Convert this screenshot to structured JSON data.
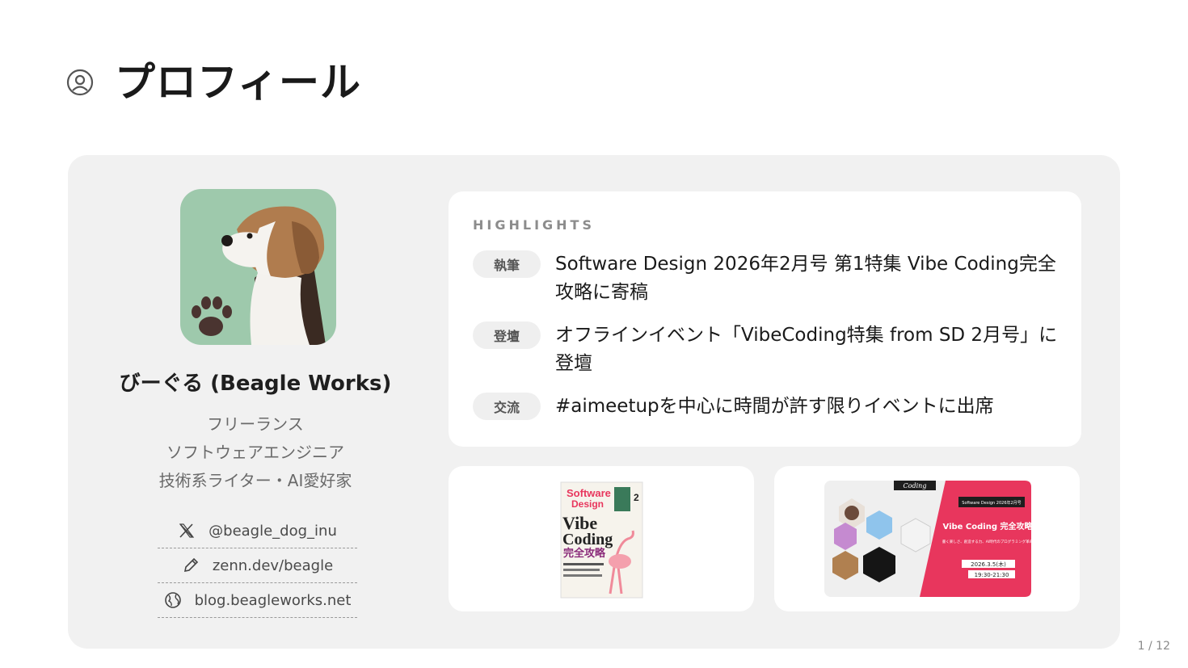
{
  "slide": {
    "title": "プロフィール",
    "page": "1 / 12"
  },
  "profile": {
    "name": "びーぐる (Beagle Works)",
    "roles": [
      "フリーランス",
      "ソフトウェアエンジニア",
      "技術系ライター・AI愛好家"
    ],
    "links": [
      {
        "icon": "x-logo-icon",
        "text": "@beagle_dog_inu"
      },
      {
        "icon": "pen-icon",
        "text": "zenn.dev/beagle"
      },
      {
        "icon": "globe-icon",
        "text": "blog.beagleworks.net"
      }
    ]
  },
  "highlights": {
    "heading": "HIGHLIGHTS",
    "items": [
      {
        "badge": "執筆",
        "text": "Software Design 2026年2月号 第1特集 Vibe Coding完全攻略に寄稿"
      },
      {
        "badge": "登壇",
        "text": "オフラインイベント「VibeCoding特集 from SD 2月号」に登壇"
      },
      {
        "badge": "交流",
        "text": "#aimeetupを中心に時間が許す限りイベントに出席"
      }
    ]
  },
  "magazine": {
    "brand_top": "Software",
    "brand_bottom": "Design",
    "issue": "2",
    "headline_1": "Vibe",
    "headline_2": "Coding",
    "headline_3": "完全攻略"
  },
  "event": {
    "brand": "Coding",
    "tag": "Software Design 2026年2月号",
    "title": "Vibe Coding 完全攻略",
    "subtitle": "書く楽しさ、創造する力、AI時代のプログラミング革命",
    "date": "2026.3.5(木)",
    "time": "19:30-21:30"
  },
  "colors": {
    "accent_pink": "#e8365d",
    "avatar_bg": "#9ec9ac",
    "card_bg": "#f1f1f1"
  }
}
